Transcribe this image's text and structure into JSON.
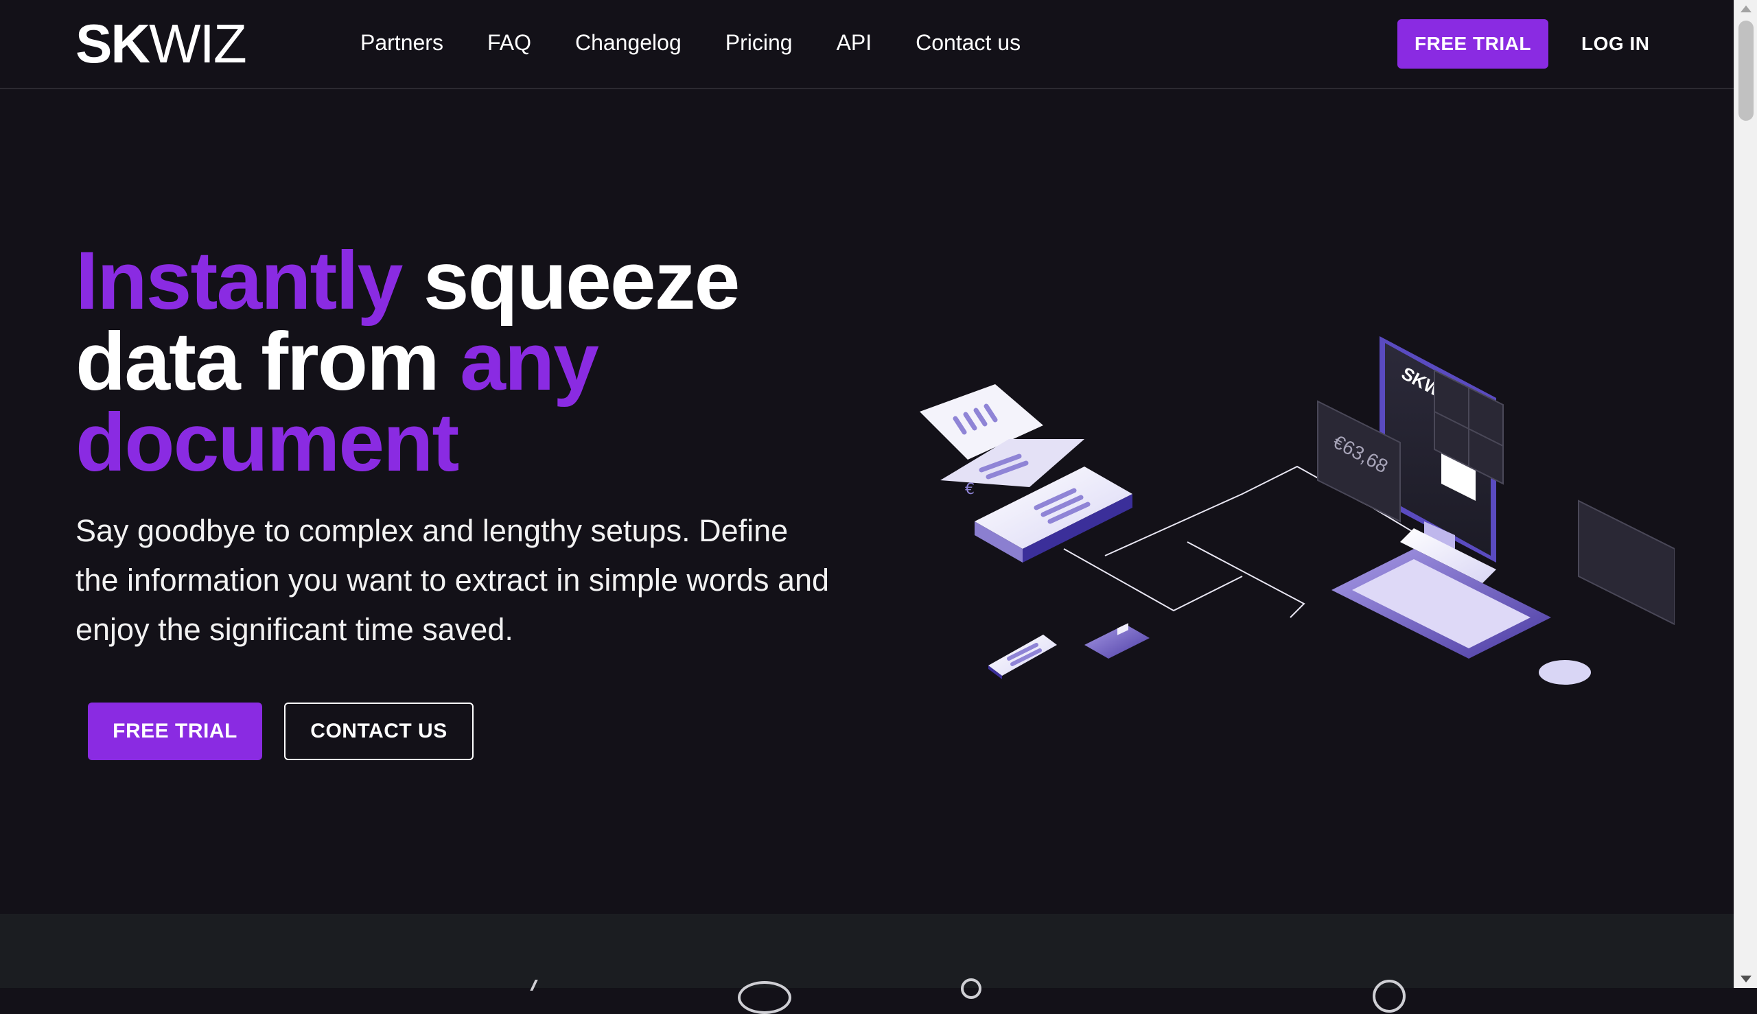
{
  "brand": {
    "logo_bold": "SK",
    "logo_light": "WIZ",
    "accent_color": "#8a2be2"
  },
  "nav": {
    "items": [
      {
        "label": "Partners"
      },
      {
        "label": "FAQ"
      },
      {
        "label": "Changelog"
      },
      {
        "label": "Pricing"
      },
      {
        "label": "API"
      },
      {
        "label": "Contact us"
      }
    ],
    "free_trial": "FREE TRIAL",
    "login": "LOG IN"
  },
  "hero": {
    "title_w1": "Instantly",
    "title_w2": "squeeze",
    "title_w3": "data from",
    "title_w4": "any",
    "title_w5": "document",
    "subtitle": "Say goodbye to complex and lengthy setups. Define the information you want to extract in simple words and enjoy the significant time saved.",
    "cta_primary": "FREE TRIAL",
    "cta_secondary": "CONTACT US"
  },
  "illustration": {
    "monitor_logo": "SKWIZ",
    "price_card": "€63,68",
    "euro_symbol": "€"
  }
}
